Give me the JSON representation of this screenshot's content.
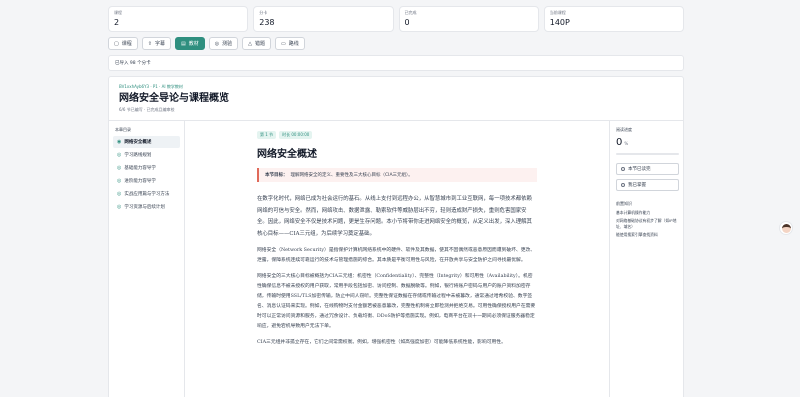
{
  "stats": [
    {
      "label": "课程",
      "value": "2"
    },
    {
      "label": "分卡",
      "value": "238"
    },
    {
      "label": "已完成",
      "value": "0"
    },
    {
      "label": "当前课程",
      "value": "140P"
    }
  ],
  "tabs": [
    {
      "label": "课程",
      "icon": "course-icon"
    },
    {
      "label": "字幕",
      "icon": "upload-icon"
    },
    {
      "label": "教材",
      "icon": "book-icon",
      "active": true
    },
    {
      "label": "测验",
      "icon": "quiz-icon"
    },
    {
      "label": "错题",
      "icon": "warning-icon"
    },
    {
      "label": "路线",
      "icon": "route-icon"
    }
  ],
  "notice": "已导入 98 个分卡",
  "course": {
    "kicker": "BV1xxhAyb6Y3 · P1 · AI 教学教材",
    "title": "网络安全导论与课程概览",
    "sub": "6/6 节已编写 · 已完成且编审校"
  },
  "sidebar": {
    "title": "本章目录",
    "items": [
      "网络安全概述",
      "学习路线规划",
      "基础能力容导学",
      "进阶能力容导学",
      "实战应用篇与学习方法",
      "学习资源与后续计划"
    ]
  },
  "section": {
    "tag": "第 1 节",
    "time": "时长 00:00:00",
    "title": "网络安全概述",
    "goal_label": "本节目标：",
    "goal_text": "理解网络安全的定义、重要性及三大核心目标（CIA三元组）。",
    "paragraphs": [
      "在数字化时代，网络已成为社会运行的基石。从线上支付到远程办公，从智慧城市到工业互联网，每一项技术都依赖网络的可信与安全。然而，网络攻击、数据泄露、勒索软件等威胁层出不穷，轻则造成财产损失，重则危害国家安全。因此，网络安全不仅是技术问题，更是生存问题。本小节将带你走进网络安全的概览，从定义出发，深入理解其核心目标——CIA三元组，为后续学习奠定基础。",
      "网络安全（Network Security）是指保护计算机网络系统中的硬件、软件及其数据，使其不因偶然或恶意原因而遭到破坏、更改、泄露，保障系统连续可靠运行的技术与管理措施的综合。其本质是平衡可用性与风险，在开放共享与安全防护之间寻找最优解。",
      "网络安全的三大核心目标被概括为CIA三元组：机密性（Confidentiality）、完整性（Integrity）和可用性（Availability）。机密性确保信息不被未授权的用户获取，常用手段包括加密、访问控制、数据脱敏等。例如，银行将账户密码与用户的账户资料加密存储，传输时使用SSL/TLS加密传输，防止中间人窃听。完整性保证数据在存储或传输过程中未被篡改，通常通过哈希校验、数字签名、消息认证码来实现。例如，在线购物时支付金额若被恶意篡改，完整性机制将立即检测并拒绝交易。可用性确保授权用户在需要时可以正常访问资源和服务，通过冗余设计、负载均衡、DDoS防护等措施实现。例如，电商平台在双十一期间必须保证服务器稳定响应，避免宕机导致用户无法下单。",
      "CIA三元组并非孤立存在，它们之间常需权衡。例如，增强机密性（如高强度加密）可能降低系统性能，影响可用性。"
    ]
  },
  "right_panel": {
    "title": "阅读进度",
    "progress_value": "0",
    "progress_unit": "%",
    "progress_fraction": 0,
    "btn_done": "本节已读完",
    "btn_master": "我已掌握",
    "related_title": "前置知识",
    "related": [
      "基本计算机操作能力",
      "对网络基础协议有初步了解（如IP地址、域名）",
      "能使用搜索引擎查找资料"
    ]
  },
  "colors": {
    "accent": "#2f8f7f",
    "goal_border": "#e06a5a"
  }
}
